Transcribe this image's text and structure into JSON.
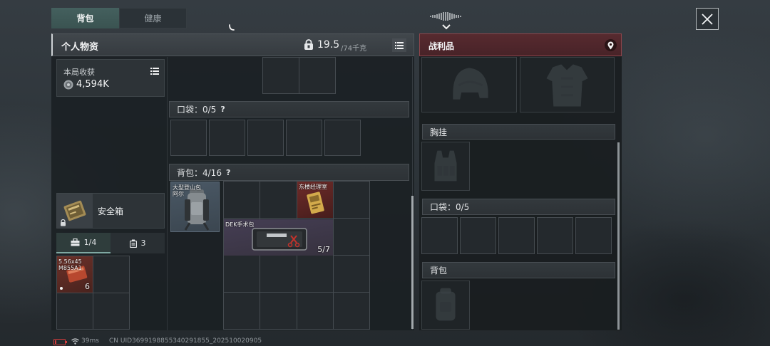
{
  "tabs": [
    {
      "label": "背包",
      "active": true
    },
    {
      "label": "健康",
      "active": false
    }
  ],
  "personal": {
    "title": "个人物资",
    "weight_current": "19.5",
    "weight_max": "/74千克"
  },
  "harvest": {
    "label": "本局收获",
    "value": "4,594K"
  },
  "safe_box": {
    "label": "安全箱",
    "tabs": [
      {
        "label": "1/4",
        "icon": "briefcase-icon",
        "active": true
      },
      {
        "label": "3",
        "icon": "container-icon",
        "active": false
      }
    ],
    "items": [
      {
        "name_line1": "5.56x45",
        "name_line2": "M855A1",
        "count": "6"
      }
    ]
  },
  "inventory": {
    "pockets_label": "口袋：0/5",
    "backpack_label": "背包：4/16",
    "help_glyph": "?",
    "backpack_equipped": {
      "name_line1": "大型登山包",
      "name_line2": "阿尔"
    },
    "items": [
      {
        "name": "东楼经理室"
      },
      {
        "name": "DEK手术包",
        "count": "5/7"
      }
    ]
  },
  "loot": {
    "title": "战利品",
    "chest_rig_label": "胸挂",
    "pockets_label": "口袋：0/5",
    "backpack_label": "背包"
  },
  "status": {
    "ping": "39ms",
    "uid": "CN UID3699198855340291855_202510020905"
  },
  "colors": {
    "active_tab": "#44605e",
    "loot_header": "#572a2f",
    "keycard_item": "#6e2b29",
    "surgical_item": "#453e54",
    "ammo_item": "#6c3129",
    "backpack_item": "#4a5865",
    "battery_low": "#d23c3c"
  },
  "icons": {
    "close": "close-icon",
    "signal": "signal-icon",
    "collapse": "chevron-down-icon",
    "weight": "weight-icon",
    "list": "list-icon",
    "location": "location-pin-icon",
    "coin": "coin-icon",
    "lock": "lock-icon",
    "help": "help-icon",
    "battery": "battery-icon",
    "wifi": "wifi-icon"
  }
}
